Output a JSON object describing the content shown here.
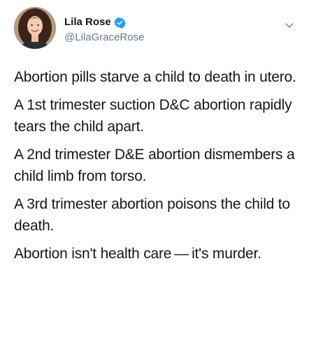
{
  "author": {
    "display_name": "Lila Rose",
    "handle": "@LilaGraceRose",
    "verified": true,
    "avatar_icon": "profile-photo",
    "verified_color": "#1da1f2"
  },
  "menu": {
    "icon": "chevron-down-icon"
  },
  "tweet": {
    "paragraphs": [
      "Abortion pills starve a child to death in utero.",
      "A 1st trimester suction D&C abortion rapidly tears the child apart.",
      "A 2nd trimester D&E abortion dismembers a child limb from torso.",
      "A 3rd trimester abortion poisons the child to death.",
      "Abortion isn't health care — it's murder."
    ]
  }
}
